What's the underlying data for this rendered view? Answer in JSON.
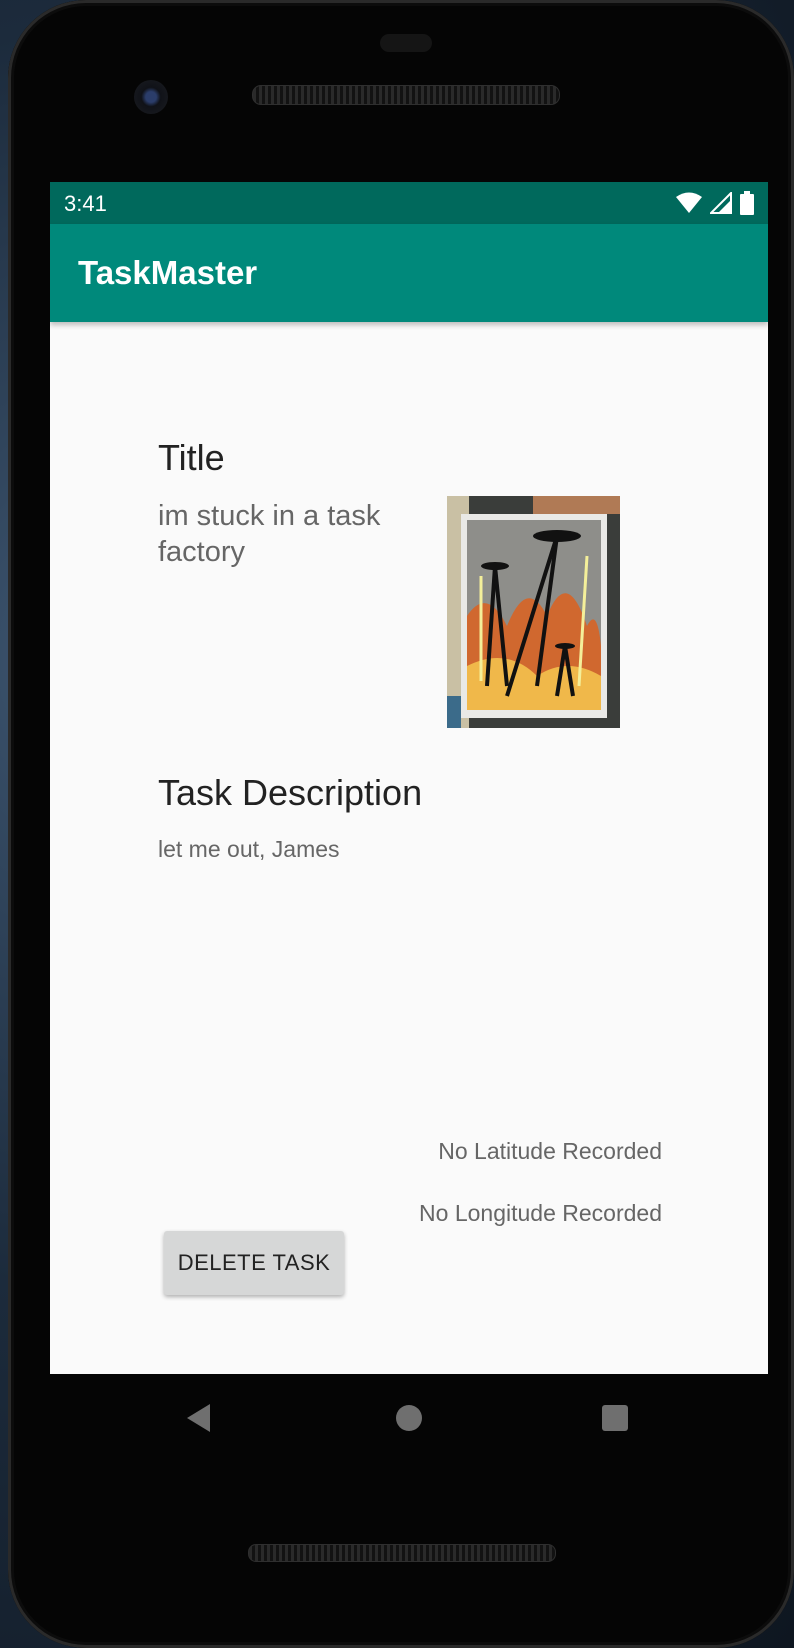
{
  "status_bar": {
    "time": "3:41",
    "icons": [
      "wifi-icon",
      "signal-icon",
      "battery-icon"
    ]
  },
  "app_bar": {
    "title": "TaskMaster",
    "color": "#00897b",
    "status_color": "#00695c"
  },
  "task": {
    "title_label": "Title",
    "title_value": "im stuck in a task factory",
    "description_label": "Task Description",
    "description_value": "let me out,  James",
    "latitude_text": "No Latitude Recorded",
    "longitude_text": "No Longitude Recorded"
  },
  "actions": {
    "delete_label": "DELETE TASK"
  },
  "nav_bar": {
    "icons": [
      "back-icon",
      "home-icon",
      "recent-apps-icon"
    ]
  }
}
